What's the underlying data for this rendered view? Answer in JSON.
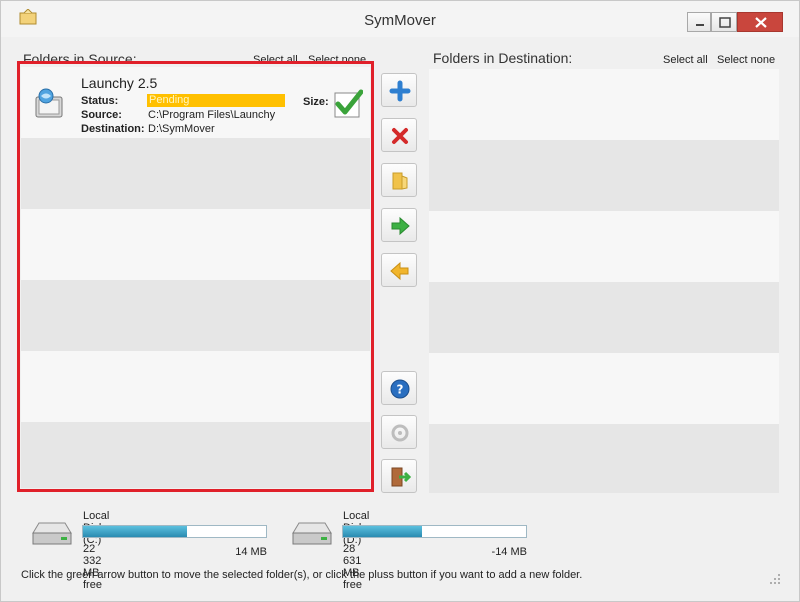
{
  "window": {
    "title": "SymMover"
  },
  "source": {
    "title": "Folders in Source:",
    "select_all": "Select all",
    "select_none": "Select none",
    "items": [
      {
        "name": "Launchy 2.5",
        "status_label": "Status:",
        "status_value": "Pending",
        "source_label": "Source:",
        "source_value": "C:\\Program Files\\Launchy",
        "destination_label": "Destination:",
        "destination_value": "D:\\SymMover",
        "size_label": "Size:"
      }
    ]
  },
  "destination": {
    "title": "Folders in Destination:",
    "select_all": "Select all",
    "select_none": "Select none"
  },
  "toolbar": {
    "icons": [
      "add-icon",
      "remove-icon",
      "folder-icon",
      "move-right-icon",
      "move-left-icon",
      "help-icon",
      "settings-icon",
      "exit-icon"
    ]
  },
  "drives": [
    {
      "name": "Local Disk (C:)",
      "free": "22 332 MB free",
      "size": "14 MB",
      "used_fraction": 0.57
    },
    {
      "name": "Local Disk (D:)",
      "free": "28 631 MB free",
      "size": "-14 MB",
      "used_fraction": 0.43
    }
  ],
  "status_text": "Click the green arrow button to move the selected folder(s), or click the pluss button if you want to add a new folder.",
  "colors": {
    "status_pending": "#ffc000",
    "highlight_border": "#e0202a",
    "close_button": "#c9463d",
    "drive_bar": "#2a8bb1"
  }
}
